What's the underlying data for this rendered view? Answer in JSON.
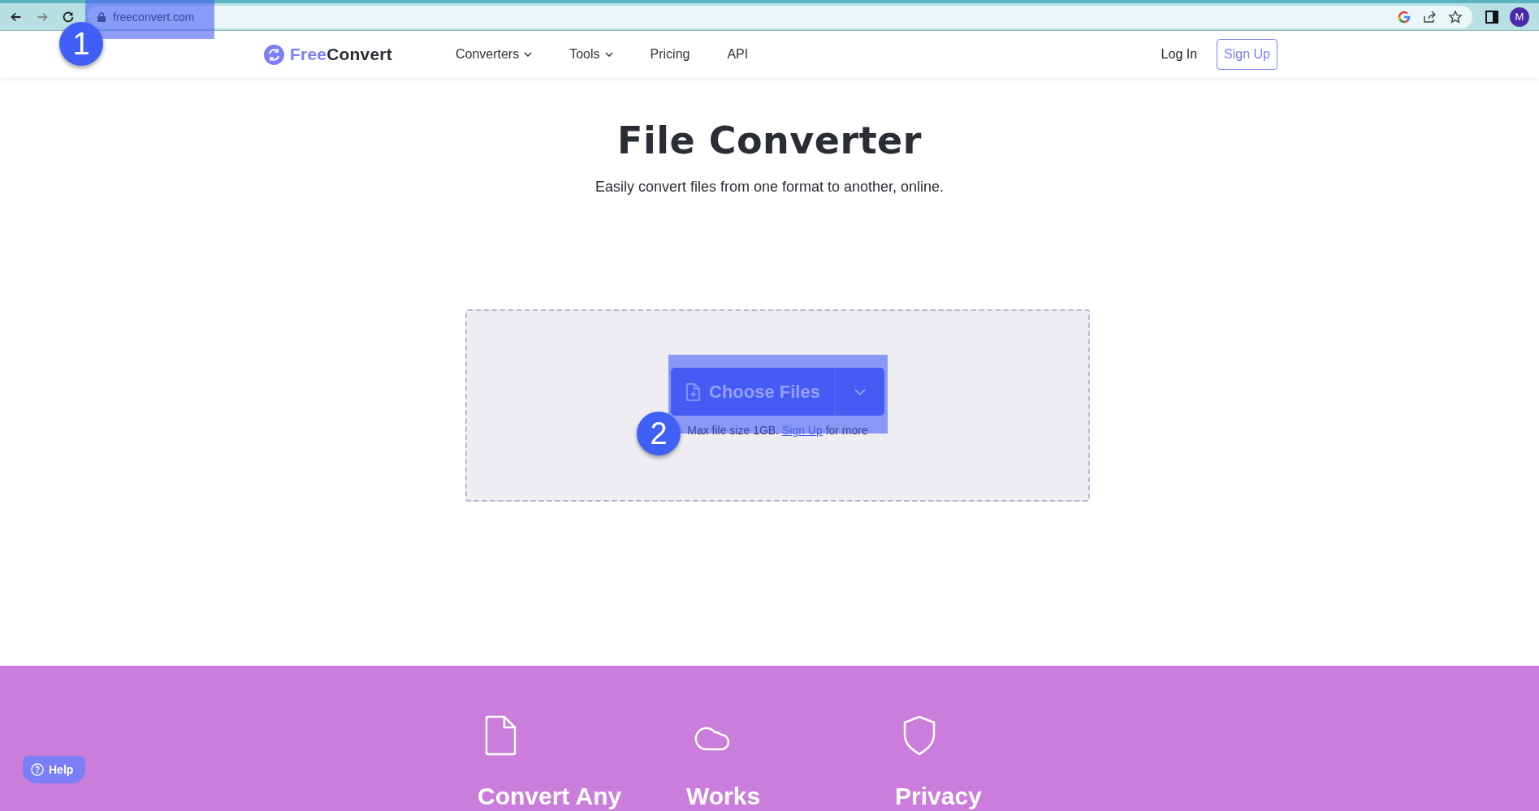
{
  "browser": {
    "url": "freeconvert.com",
    "profile_initial": "M"
  },
  "nav": {
    "logo": {
      "first": "Free",
      "second": "Convert"
    },
    "menu": [
      {
        "label": "Converters",
        "dropdown": true
      },
      {
        "label": "Tools",
        "dropdown": true
      },
      {
        "label": "Pricing",
        "dropdown": false
      },
      {
        "label": "API",
        "dropdown": false
      }
    ],
    "login": "Log In",
    "signup": "Sign Up"
  },
  "hero": {
    "title": "File Converter",
    "subtitle": "Easily convert files from one format to another, online."
  },
  "upload": {
    "button": "Choose Files",
    "note_before": "Max file size 1GB.",
    "note_link": "Sign Up",
    "note_after": "for more"
  },
  "features": [
    {
      "kind": "file",
      "title": "Convert Any"
    },
    {
      "kind": "cloud",
      "title": "Works"
    },
    {
      "kind": "shield",
      "title": "Privacy"
    }
  ],
  "help": "Help",
  "annotations": [
    {
      "label": "1"
    },
    {
      "label": "2"
    }
  ]
}
